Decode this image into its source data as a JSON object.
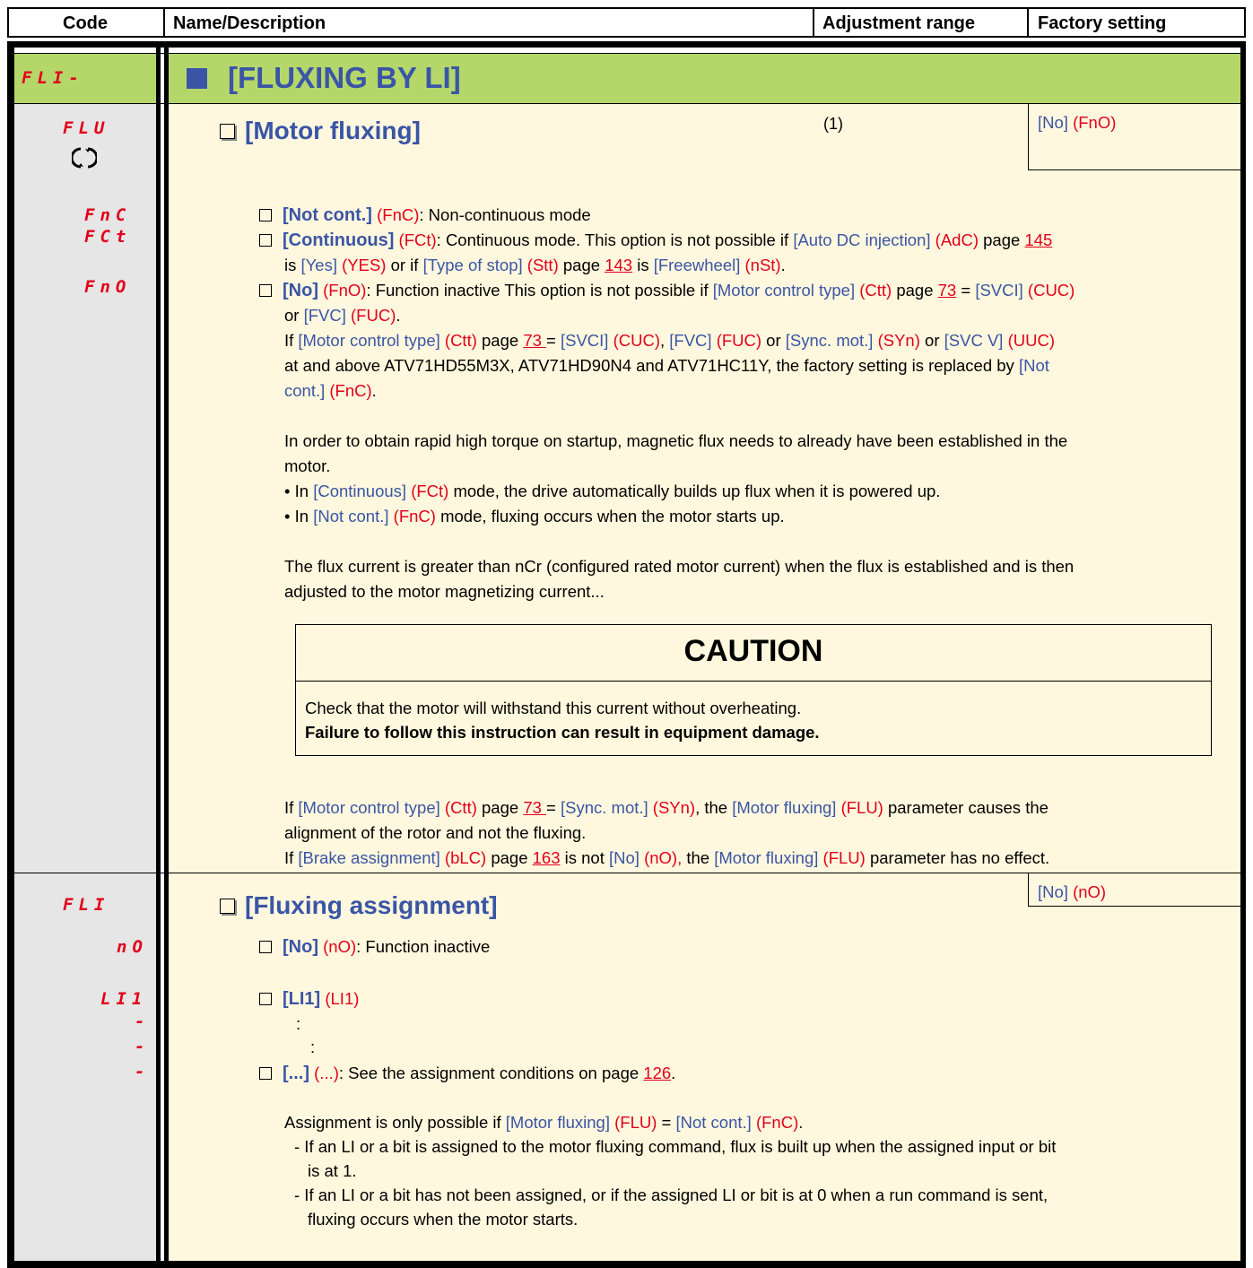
{
  "header": {
    "code": "Code",
    "name": "Name/Description",
    "range": "Adjustment range",
    "factory": "Factory setting"
  },
  "menu": {
    "code": "FLI-",
    "title": "[FLUXING BY LI]"
  },
  "flu": {
    "code": "FLU",
    "title": "[Motor fluxing]",
    "note": "(1)",
    "default_name": "[No]",
    "default_code": "(FnO)",
    "opt_codes": [
      "FnC",
      "FCt",
      "FnO"
    ],
    "opt1": {
      "name": "[Not cont.]",
      "code": "(FnC)",
      "desc": ": Non-continuous mode"
    },
    "opt2": {
      "name": "[Continuous]",
      "code": "(FCt)",
      "l1a": ": Continuous mode. This option is not possible if ",
      "l1b": "[Auto DC injection]",
      "l1c": "(AdC)",
      "l1d": " page ",
      "l1e": "145",
      "l2a": "is ",
      "l2b": "[Yes]",
      "l2c": "(YES)",
      "l2d": " or if ",
      "l2e": "[Type of stop]",
      "l2f": "(Stt)",
      "l2g": " page ",
      "l2h": "143",
      "l2i": " is ",
      "l2j": "[Freewheel]",
      "l2k": "(nSt)",
      "l2l": "."
    },
    "opt3": {
      "name": "[No]",
      "code": "(FnO)",
      "l1a": ": Function inactive This option is not possible if ",
      "l1b": "[Motor control type]",
      "l1c": "(Ctt)",
      "l1d": " page ",
      "l1e": "73",
      "l1f": " = ",
      "l1g": "[SVCI]",
      "l1h": "(CUC)",
      "l2a": "or ",
      "l2b": "[FVC]",
      "l2c": "(FUC)",
      "l2d": ".",
      "l3a": "If ",
      "l3b": "[Motor control type]",
      "l3c": "(Ctt)",
      "l3d": " page ",
      "l3e": "73 ",
      "l3f": "= ",
      "l3g": "[SVCI]",
      "l3h": "(CUC)",
      "l3i": ", ",
      "l3j": "[FVC]",
      "l3k": "(FUC)",
      "l3l": " or ",
      "l3m": "[Sync. mot.]",
      "l3n": "(SYn)",
      "l3o": " or ",
      "l3p": "[SVC V]",
      "l3q": "(UUC)",
      "l4a": "at and above ATV71HD55M3X, ATV71HD90N4 and ATV71HC11Y, the factory setting is replaced by ",
      "l4b": "[Not",
      "l5a": "cont.]",
      "l5b": "(FnC)",
      "l5c": "."
    },
    "para1_l1": "In order to obtain rapid high torque on startup, magnetic flux needs to already have been established in the",
    "para1_l2": "motor.",
    "bullet1": {
      "a": "• In ",
      "b": "[Continuous]",
      "c": "(FCt)",
      "d": " mode, the drive automatically builds up flux when it is powered up."
    },
    "bullet2": {
      "a": "• In ",
      "b": "[Not cont.]",
      "c": "(FnC)",
      "d": " mode, fluxing occurs when the motor starts up."
    },
    "para2_l1": "The flux current is greater than nCr (configured rated motor current) when the flux is established and is then",
    "para2_l2": "adjusted to the motor magnetizing current...",
    "caution": {
      "title": "CAUTION",
      "text": "Check that the motor will withstand this current without overheating.",
      "bold": "Failure to follow this instruction can result in equipment damage."
    },
    "para3": {
      "a": "If ",
      "b": "[Motor control type]",
      "c": "(Ctt)",
      "d": " page ",
      "e": "73 ",
      "f": "= ",
      "g": "[Sync. mot.]",
      "h": "(SYn)",
      "i": ", the ",
      "j": "[Motor fluxing]",
      "k": "(FLU)",
      "l": " parameter causes the",
      "l2": "alignment of the rotor and not the fluxing."
    },
    "para4": {
      "a": "If ",
      "b": "[Brake assignment]",
      "c": "(bLC)",
      "d": " page ",
      "e": "163",
      "f": " is not ",
      "g": "[No]",
      "h": "(nO),",
      "i": " the ",
      "j": "[Motor fluxing]",
      "k": "(FLU)",
      "l": " parameter has no effect."
    }
  },
  "fli": {
    "code": "FLI",
    "title": "[Fluxing assignment]",
    "default_name": "[No]",
    "default_code": "(nO)",
    "opt_codes": [
      "nO",
      "LI1",
      "-",
      "-",
      "-"
    ],
    "opt1": {
      "name": "[No]",
      "code": "(nO)",
      "desc": ": Function inactive"
    },
    "opt2": {
      "name": "[LI1]",
      "code": "(LI1)"
    },
    "dots": ":",
    "opt3": {
      "name": "[...]",
      "code": "(...)",
      "desc": ": See the assignment conditions on page ",
      "page": "126",
      "end": "."
    },
    "assign": {
      "a": "Assignment is only possible if ",
      "b": "[Motor fluxing]",
      "c": "(FLU)",
      "d": " = ",
      "e": "[Not cont.]",
      "f": "(FnC)",
      "g": "."
    },
    "dash1_l1": "- If an LI or a bit is assigned to the motor fluxing command, flux is built up when the assigned input or bit",
    "dash1_l2": "is at 1.",
    "dash2_l1": "- If an LI or a bit has not been assigned, or if the assigned LI or bit is at 0 when a run command is sent,",
    "dash2_l2": "fluxing occurs when the motor starts."
  },
  "colors": {
    "menu_band": "#b5d76a",
    "code_column": "#e6e6e6",
    "content": "#fff8de",
    "code_red": "#e2001a",
    "link_blue": "#3a55a6"
  }
}
